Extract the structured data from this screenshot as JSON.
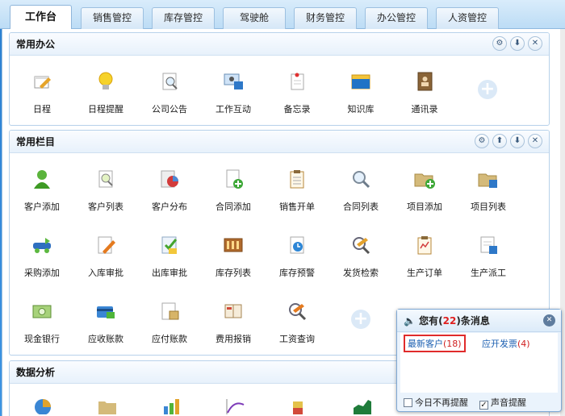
{
  "tabs": [
    {
      "label": "工作台",
      "active": true
    },
    {
      "label": "销售管控"
    },
    {
      "label": "库存管控"
    },
    {
      "label": "驾驶舱"
    },
    {
      "label": "财务管控"
    },
    {
      "label": "办公管控"
    },
    {
      "label": "人资管控"
    }
  ],
  "office": {
    "title": "常用办公",
    "items": [
      {
        "label": "日程",
        "icon": "schedule-icon"
      },
      {
        "label": "日程提醒",
        "icon": "lightbulb-icon"
      },
      {
        "label": "公司公告",
        "icon": "announcement-icon"
      },
      {
        "label": "工作互动",
        "icon": "interaction-icon"
      },
      {
        "label": "备忘录",
        "icon": "memo-icon"
      },
      {
        "label": "知识库",
        "icon": "knowledge-base-icon"
      },
      {
        "label": "通讯录",
        "icon": "address-book-icon"
      }
    ]
  },
  "columns": {
    "title": "常用栏目",
    "items": [
      {
        "label": "客户添加",
        "icon": "add-customer-icon"
      },
      {
        "label": "客户列表",
        "icon": "customer-list-icon"
      },
      {
        "label": "客户分布",
        "icon": "customer-distribution-icon"
      },
      {
        "label": "合同添加",
        "icon": "add-contract-icon"
      },
      {
        "label": "销售开单",
        "icon": "sales-order-icon"
      },
      {
        "label": "合同列表",
        "icon": "contract-list-icon"
      },
      {
        "label": "项目添加",
        "icon": "add-project-icon"
      },
      {
        "label": "项目列表",
        "icon": "project-list-icon"
      },
      {
        "label": "采购添加",
        "icon": "add-purchase-icon"
      },
      {
        "label": "入库审批",
        "icon": "inbound-approval-icon"
      },
      {
        "label": "出库审批",
        "icon": "outbound-approval-icon"
      },
      {
        "label": "库存列表",
        "icon": "inventory-list-icon"
      },
      {
        "label": "库存预警",
        "icon": "inventory-alert-icon"
      },
      {
        "label": "发货检索",
        "icon": "shipment-search-icon"
      },
      {
        "label": "生产订单",
        "icon": "production-order-icon"
      },
      {
        "label": "生产派工",
        "icon": "production-dispatch-icon"
      },
      {
        "label": "现金银行",
        "icon": "cash-bank-icon"
      },
      {
        "label": "应收账款",
        "icon": "receivables-icon"
      },
      {
        "label": "应付账款",
        "icon": "payables-icon"
      },
      {
        "label": "费用报销",
        "icon": "expense-icon"
      },
      {
        "label": "工资查询",
        "icon": "salary-query-icon"
      }
    ]
  },
  "analysis": {
    "title": "数据分析"
  },
  "popup": {
    "prefix": "您有",
    "paren_open": "(",
    "count": "22",
    "paren_close": ")",
    "suffix": "条消息",
    "links": [
      {
        "label": "最新客户",
        "count": "(18)"
      },
      {
        "label": "应开发票",
        "count": "(4)"
      }
    ],
    "options": [
      {
        "label": "今日不再提醒",
        "checked": false
      },
      {
        "label": "声音提醒",
        "checked": true
      }
    ]
  }
}
